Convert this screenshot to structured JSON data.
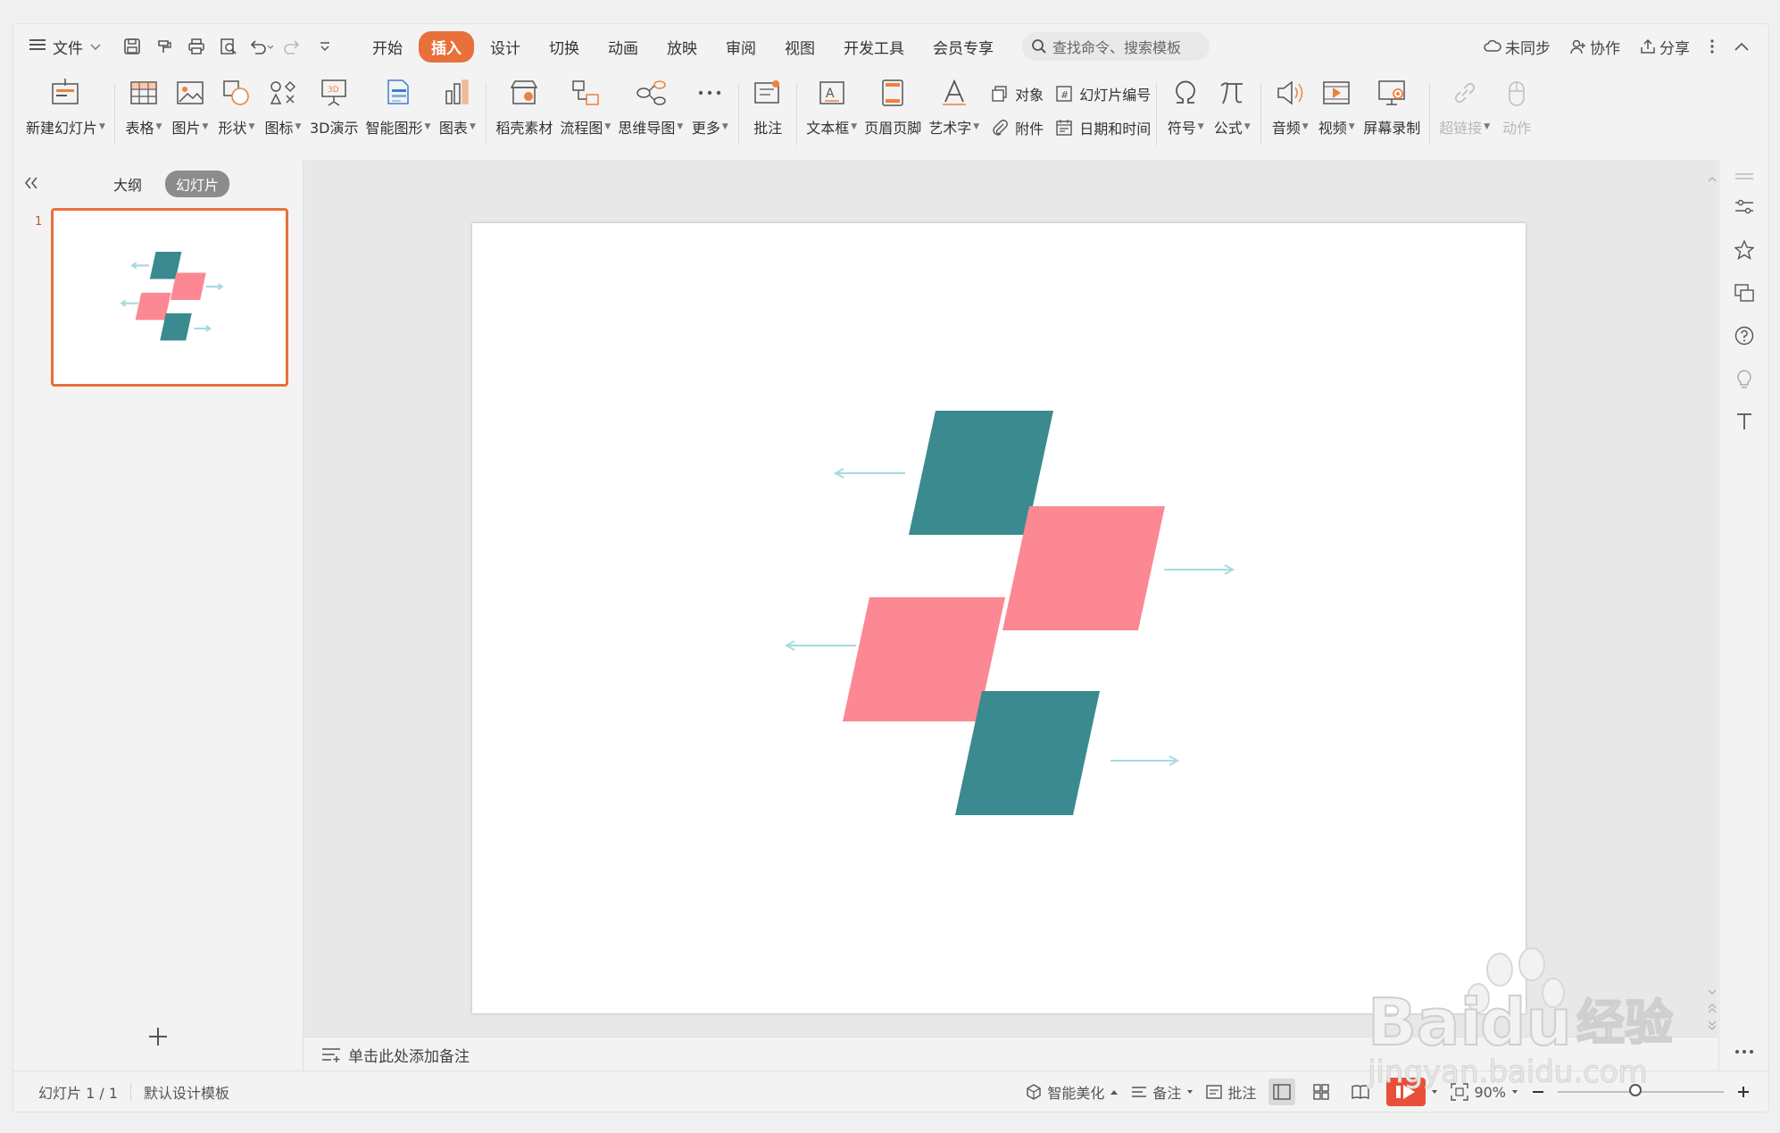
{
  "menubar": {
    "file_label": "文件",
    "tabs": [
      {
        "label": "开始",
        "active": false
      },
      {
        "label": "插入",
        "active": true
      },
      {
        "label": "设计",
        "active": false
      },
      {
        "label": "切换",
        "active": false
      },
      {
        "label": "动画",
        "active": false
      },
      {
        "label": "放映",
        "active": false
      },
      {
        "label": "审阅",
        "active": false
      },
      {
        "label": "视图",
        "active": false
      },
      {
        "label": "开发工具",
        "active": false
      },
      {
        "label": "会员专享",
        "active": false
      }
    ],
    "search_placeholder": "查找命令、搜索模板",
    "right": {
      "sync": "未同步",
      "collab": "协作",
      "share": "分享"
    }
  },
  "ribbon": {
    "new_slide": "新建幻灯片",
    "table": "表格",
    "picture": "图片",
    "shape": "形状",
    "icon": "图标",
    "demo3d": "3D演示",
    "smartart": "智能图形",
    "chart": "图表",
    "material": "稻壳素材",
    "flowchart": "流程图",
    "mindmap": "思维导图",
    "more": "更多",
    "comment": "批注",
    "textbox": "文本框",
    "header_footer": "页眉页脚",
    "wordart": "艺术字",
    "object": "对象",
    "attachment": "附件",
    "slide_number": "幻灯片编号",
    "datetime": "日期和时间",
    "symbol": "符号",
    "formula": "公式",
    "audio": "音频",
    "video": "视频",
    "screen_record": "屏幕录制",
    "hyperlink": "超链接",
    "action": "动作"
  },
  "left_panel": {
    "tab_outline": "大纲",
    "tab_slides": "幻灯片",
    "slide_number": "1"
  },
  "notes": {
    "placeholder": "单击此处添加备注"
  },
  "status": {
    "slide_info": "幻灯片 1 / 1",
    "template": "默认设计模板",
    "beautify": "智能美化",
    "notes": "备注",
    "comments": "批注",
    "zoom": "90%"
  },
  "colors": {
    "accent": "#e8703a",
    "teal": "#3a8a90",
    "pink": "#fb8893",
    "arrow": "#a7dadd"
  },
  "watermark": {
    "brand": "Baidu",
    "cn": "经验",
    "url": "jingyan.baidu.com"
  }
}
